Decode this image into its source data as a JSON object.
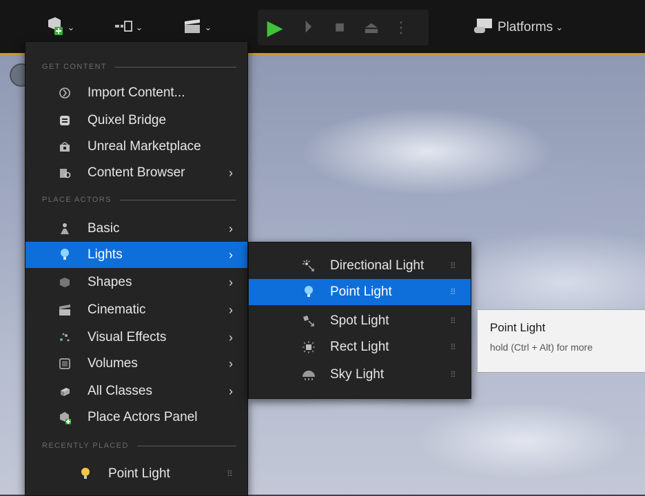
{
  "toolbar": {
    "groups": [
      {
        "name": "create",
        "icons": [
          "add-content-icon"
        ]
      },
      {
        "name": "snap",
        "icons": [
          "modes-icon"
        ]
      },
      {
        "name": "cinematics",
        "icons": [
          "clapperboard-icon"
        ]
      }
    ],
    "play_controls": [
      "play-icon",
      "advance-frame-icon",
      "stop-icon",
      "eject-icon",
      "more-options-icon"
    ],
    "platforms_label": "Platforms",
    "accent_color": "#c79a3a"
  },
  "menu": {
    "sections": {
      "get_content": "GET CONTENT",
      "place_actors": "PLACE ACTORS",
      "recently_placed": "RECENTLY PLACED"
    },
    "get_content_items": [
      {
        "label": "Import Content...",
        "icon": "import-icon"
      },
      {
        "label": "Quixel Bridge",
        "icon": "bridge-icon"
      },
      {
        "label": "Unreal Marketplace",
        "icon": "marketplace-icon"
      },
      {
        "label": "Content Browser",
        "icon": "content-browser-icon",
        "submenu": true
      }
    ],
    "place_actors_items": [
      {
        "label": "Basic",
        "icon": "basic-actors-icon",
        "submenu": true
      },
      {
        "label": "Lights",
        "icon": "light-bulb-icon",
        "submenu": true,
        "selected": true
      },
      {
        "label": "Shapes",
        "icon": "shapes-icon",
        "submenu": true
      },
      {
        "label": "Cinematic",
        "icon": "clapperboard-icon",
        "submenu": true
      },
      {
        "label": "Visual Effects",
        "icon": "visual-effects-icon",
        "submenu": true
      },
      {
        "label": "Volumes",
        "icon": "volume-icon",
        "submenu": true
      },
      {
        "label": "All Classes",
        "icon": "all-classes-icon",
        "submenu": true
      },
      {
        "label": "Place Actors Panel",
        "icon": "place-actors-icon"
      }
    ],
    "recently_placed_items": [
      {
        "label": "Point Light",
        "icon": "light-bulb-icon"
      }
    ],
    "selected_color": "#0e6fdb"
  },
  "lights_submenu": {
    "items": [
      {
        "label": "Directional Light",
        "icon": "directional-light-icon"
      },
      {
        "label": "Point Light",
        "icon": "point-light-icon",
        "selected": true
      },
      {
        "label": "Spot Light",
        "icon": "spot-light-icon"
      },
      {
        "label": "Rect Light",
        "icon": "rect-light-icon"
      },
      {
        "label": "Sky Light",
        "icon": "sky-light-icon"
      }
    ]
  },
  "tooltip": {
    "title": "Point Light",
    "hint": "hold (Ctrl + Alt) for more"
  }
}
